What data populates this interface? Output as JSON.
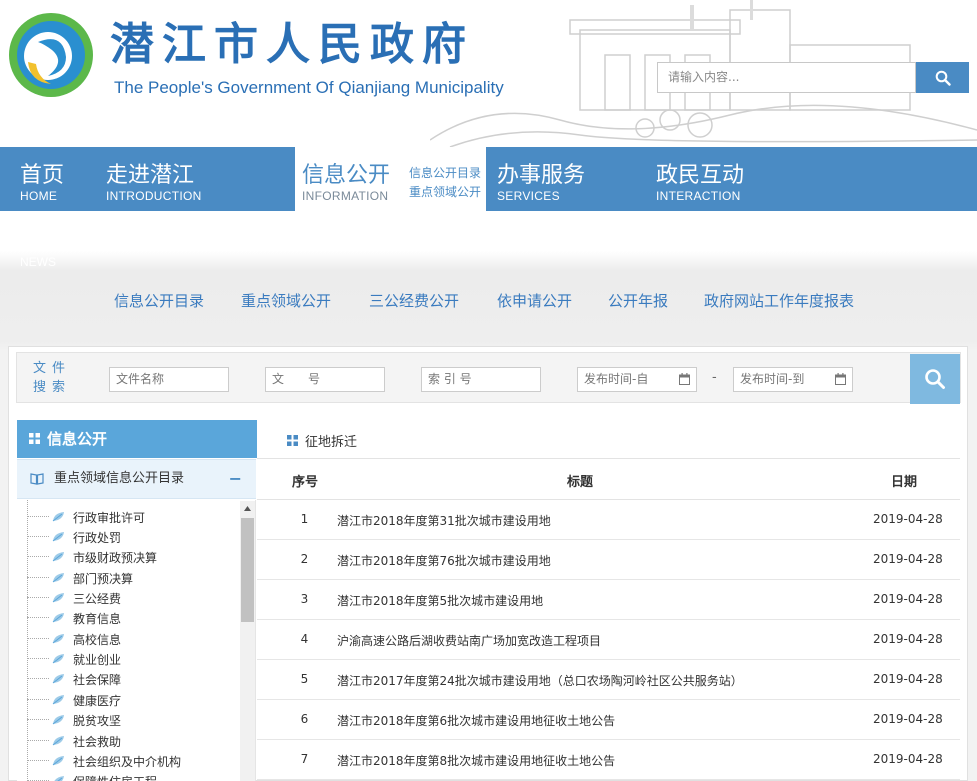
{
  "header": {
    "title": "潜江市人民政府",
    "subtitle": "The People's Government Of Qianjiang Municipality",
    "search_placeholder": "请输入内容..."
  },
  "nav": {
    "items": [
      {
        "cn": "首页",
        "en": "HOME"
      },
      {
        "cn": "走进潜江",
        "en": "INTRODUCTION"
      },
      {
        "cn": "信息公开",
        "en": "INFORMATION"
      },
      {
        "cn": "办事服务",
        "en": "SERVICES"
      },
      {
        "cn": "政民互动",
        "en": "INTERACTION"
      }
    ],
    "active_sub": [
      "信息公开目录",
      "重点领域公开"
    ]
  },
  "band": {
    "watermark": "NEWS",
    "subnav": [
      "信息公开目录",
      "重点领域公开",
      "三公经费公开",
      "依申请公开",
      "公开年报",
      "政府网站工作年度报表"
    ]
  },
  "filter": {
    "label": "文件搜索",
    "file_name": "文件名称",
    "doc_no": "文　　号",
    "index_no": "索 引 号",
    "date_from": "发布时间-自",
    "date_sep": "-",
    "date_to": "发布时间-到"
  },
  "sidebar": {
    "title": "信息公开",
    "category": "重点领域信息公开目录",
    "collapse": "−",
    "items": [
      "行政审批许可",
      "行政处罚",
      "市级财政预决算",
      "部门预决算",
      "三公经费",
      "教育信息",
      "高校信息",
      "就业创业",
      "社会保障",
      "健康医疗",
      "脱贫攻坚",
      "社会救助",
      "社会组织及中介机构",
      "保障性住房工程"
    ]
  },
  "content": {
    "breadcrumb": "征地拆迁",
    "columns": {
      "index": "序号",
      "title": "标题",
      "date": "日期"
    },
    "rows": [
      {
        "index": "1",
        "title": "潜江市2018年度第31批次城市建设用地",
        "date": "2019-04-28"
      },
      {
        "index": "2",
        "title": "潜江市2018年度第76批次城市建设用地",
        "date": "2019-04-28"
      },
      {
        "index": "3",
        "title": "潜江市2018年度第5批次城市建设用地",
        "date": "2019-04-28"
      },
      {
        "index": "4",
        "title": "沪渝高速公路后湖收费站南广场加宽改造工程项目",
        "date": "2019-04-28"
      },
      {
        "index": "5",
        "title": "潜江市2017年度第24批次城市建设用地（总口农场陶河岭社区公共服务站）",
        "date": "2019-04-28"
      },
      {
        "index": "6",
        "title": "潜江市2018年度第6批次城市建设用地征收土地公告",
        "date": "2019-04-28"
      },
      {
        "index": "7",
        "title": "潜江市2018年度第8批次城市建设用地征收土地公告",
        "date": "2019-04-28"
      }
    ]
  },
  "colors": {
    "brand": "#4a8bc4",
    "accent": "#5aa6da",
    "link": "#3a7bbf"
  }
}
